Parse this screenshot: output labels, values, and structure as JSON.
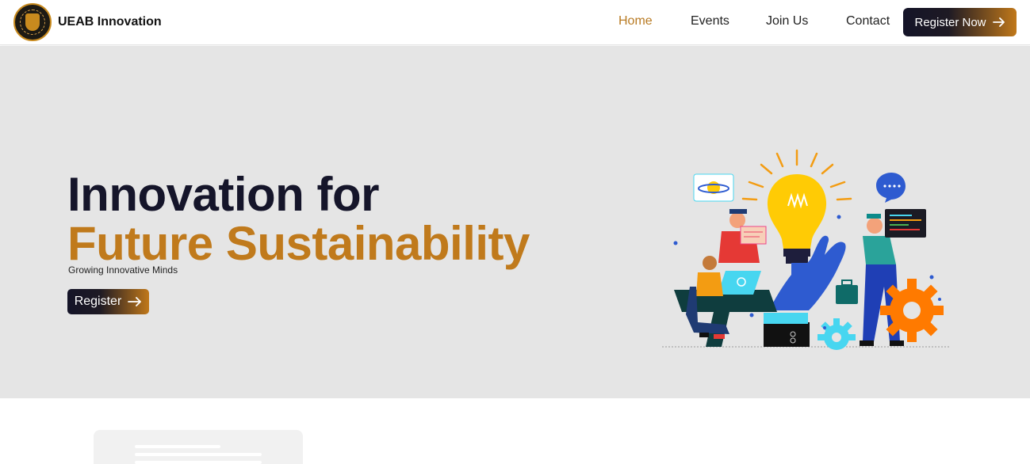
{
  "navbar": {
    "brand": "UEAB Innovation",
    "links": [
      {
        "label": "Home",
        "active": true
      },
      {
        "label": "Events",
        "active": false
      },
      {
        "label": "Join Us",
        "active": false
      },
      {
        "label": "Contact",
        "active": false
      }
    ],
    "cta": {
      "label": "Register Now",
      "icon": "arrow-right-icon"
    }
  },
  "hero": {
    "title_line1": "Innovation for",
    "title_line2": "Future Sustainability",
    "subtitle": "Growing Innovative Minds",
    "button": {
      "label": "Register",
      "icon": "arrow-right-icon"
    }
  },
  "colors": {
    "accent": "#c07a1c",
    "dark": "#15152a",
    "hero_bg": "#e5e5e5"
  }
}
